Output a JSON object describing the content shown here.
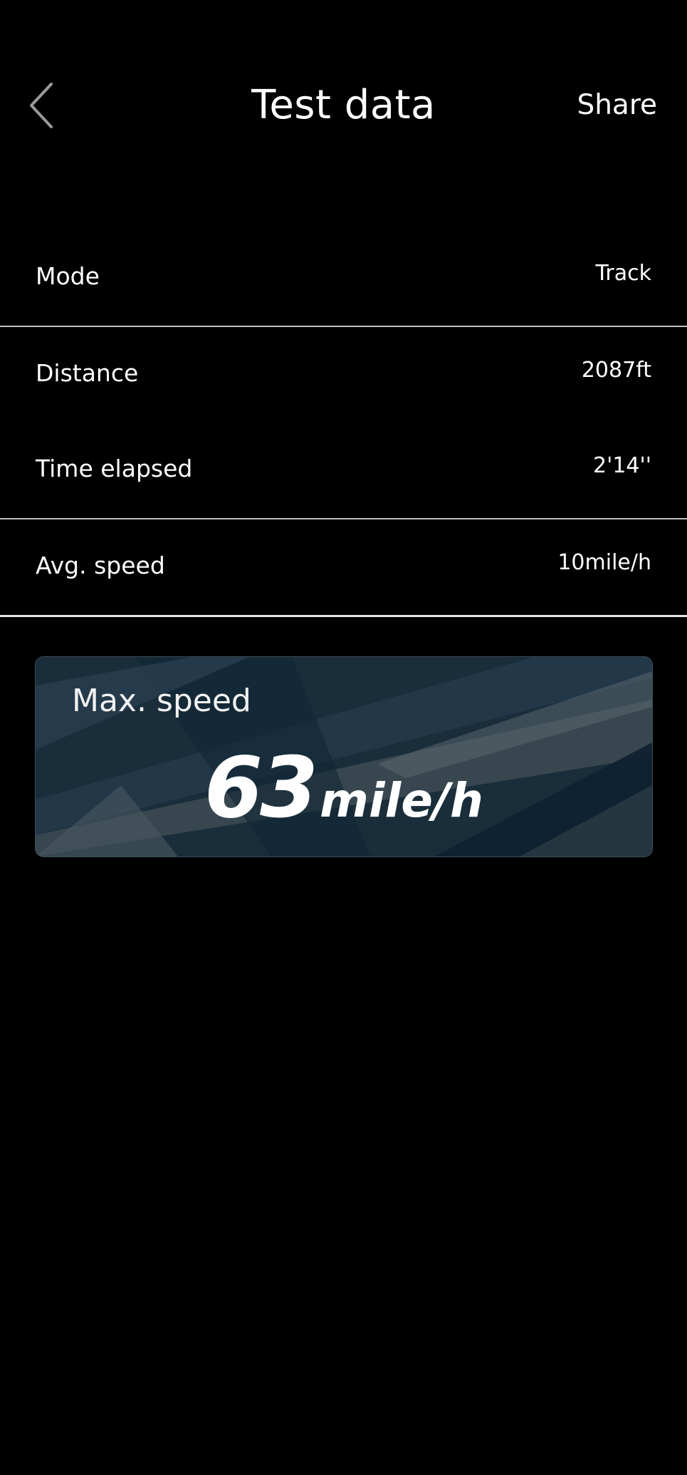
{
  "header": {
    "title": "Test data",
    "share_label": "Share",
    "back_icon": "chevron-left-icon"
  },
  "rows": [
    {
      "label": "Mode",
      "value": "Track"
    },
    {
      "label": "Distance",
      "value": "2087ft"
    },
    {
      "label": "Time elapsed",
      "value": "2'14''"
    },
    {
      "label": "Avg. speed",
      "value": "10mile/h"
    }
  ],
  "max_speed": {
    "label": "Max. speed",
    "value": "63",
    "unit": "mile/h"
  },
  "colors": {
    "background": "#000000",
    "text": "#ffffff",
    "card_bg": "#1b2c38"
  }
}
